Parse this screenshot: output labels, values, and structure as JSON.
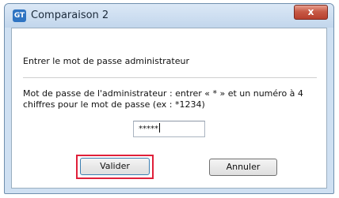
{
  "window": {
    "title": "Comparaison 2",
    "app_icon": "GT",
    "close_glyph": "x"
  },
  "content": {
    "heading": "Entrer le mot de passe administrateur",
    "description": "Mot de passe de l'administrateur : entrer « * » et un numéro à 4 chiffres pour le mot de passe (ex : *1234)"
  },
  "password_field": {
    "value": "*****"
  },
  "buttons": {
    "ok_label": "Valider",
    "cancel_label": "Annuler"
  },
  "colors": {
    "highlight": "#e0203a",
    "close_button": "#c75a46"
  }
}
